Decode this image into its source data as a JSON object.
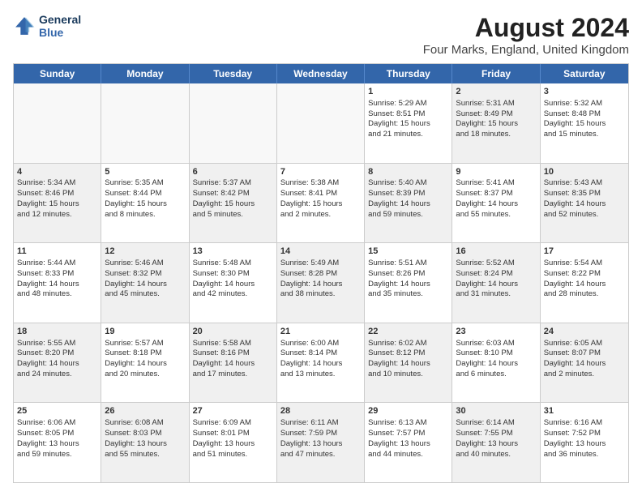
{
  "logo": {
    "line1": "General",
    "line2": "Blue"
  },
  "title": "August 2024",
  "subtitle": "Four Marks, England, United Kingdom",
  "header_days": [
    "Sunday",
    "Monday",
    "Tuesday",
    "Wednesday",
    "Thursday",
    "Friday",
    "Saturday"
  ],
  "rows": [
    [
      {
        "day": "",
        "content": "",
        "empty": true
      },
      {
        "day": "",
        "content": "",
        "empty": true
      },
      {
        "day": "",
        "content": "",
        "empty": true
      },
      {
        "day": "",
        "content": "",
        "empty": true
      },
      {
        "day": "1",
        "content": "Sunrise: 5:29 AM\nSunset: 8:51 PM\nDaylight: 15 hours\nand 21 minutes.",
        "empty": false,
        "shaded": false
      },
      {
        "day": "2",
        "content": "Sunrise: 5:31 AM\nSunset: 8:49 PM\nDaylight: 15 hours\nand 18 minutes.",
        "empty": false,
        "shaded": true
      },
      {
        "day": "3",
        "content": "Sunrise: 5:32 AM\nSunset: 8:48 PM\nDaylight: 15 hours\nand 15 minutes.",
        "empty": false,
        "shaded": false
      }
    ],
    [
      {
        "day": "4",
        "content": "Sunrise: 5:34 AM\nSunset: 8:46 PM\nDaylight: 15 hours\nand 12 minutes.",
        "empty": false,
        "shaded": true
      },
      {
        "day": "5",
        "content": "Sunrise: 5:35 AM\nSunset: 8:44 PM\nDaylight: 15 hours\nand 8 minutes.",
        "empty": false,
        "shaded": false
      },
      {
        "day": "6",
        "content": "Sunrise: 5:37 AM\nSunset: 8:42 PM\nDaylight: 15 hours\nand 5 minutes.",
        "empty": false,
        "shaded": true
      },
      {
        "day": "7",
        "content": "Sunrise: 5:38 AM\nSunset: 8:41 PM\nDaylight: 15 hours\nand 2 minutes.",
        "empty": false,
        "shaded": false
      },
      {
        "day": "8",
        "content": "Sunrise: 5:40 AM\nSunset: 8:39 PM\nDaylight: 14 hours\nand 59 minutes.",
        "empty": false,
        "shaded": true
      },
      {
        "day": "9",
        "content": "Sunrise: 5:41 AM\nSunset: 8:37 PM\nDaylight: 14 hours\nand 55 minutes.",
        "empty": false,
        "shaded": false
      },
      {
        "day": "10",
        "content": "Sunrise: 5:43 AM\nSunset: 8:35 PM\nDaylight: 14 hours\nand 52 minutes.",
        "empty": false,
        "shaded": true
      }
    ],
    [
      {
        "day": "11",
        "content": "Sunrise: 5:44 AM\nSunset: 8:33 PM\nDaylight: 14 hours\nand 48 minutes.",
        "empty": false,
        "shaded": false
      },
      {
        "day": "12",
        "content": "Sunrise: 5:46 AM\nSunset: 8:32 PM\nDaylight: 14 hours\nand 45 minutes.",
        "empty": false,
        "shaded": true
      },
      {
        "day": "13",
        "content": "Sunrise: 5:48 AM\nSunset: 8:30 PM\nDaylight: 14 hours\nand 42 minutes.",
        "empty": false,
        "shaded": false
      },
      {
        "day": "14",
        "content": "Sunrise: 5:49 AM\nSunset: 8:28 PM\nDaylight: 14 hours\nand 38 minutes.",
        "empty": false,
        "shaded": true
      },
      {
        "day": "15",
        "content": "Sunrise: 5:51 AM\nSunset: 8:26 PM\nDaylight: 14 hours\nand 35 minutes.",
        "empty": false,
        "shaded": false
      },
      {
        "day": "16",
        "content": "Sunrise: 5:52 AM\nSunset: 8:24 PM\nDaylight: 14 hours\nand 31 minutes.",
        "empty": false,
        "shaded": true
      },
      {
        "day": "17",
        "content": "Sunrise: 5:54 AM\nSunset: 8:22 PM\nDaylight: 14 hours\nand 28 minutes.",
        "empty": false,
        "shaded": false
      }
    ],
    [
      {
        "day": "18",
        "content": "Sunrise: 5:55 AM\nSunset: 8:20 PM\nDaylight: 14 hours\nand 24 minutes.",
        "empty": false,
        "shaded": true
      },
      {
        "day": "19",
        "content": "Sunrise: 5:57 AM\nSunset: 8:18 PM\nDaylight: 14 hours\nand 20 minutes.",
        "empty": false,
        "shaded": false
      },
      {
        "day": "20",
        "content": "Sunrise: 5:58 AM\nSunset: 8:16 PM\nDaylight: 14 hours\nand 17 minutes.",
        "empty": false,
        "shaded": true
      },
      {
        "day": "21",
        "content": "Sunrise: 6:00 AM\nSunset: 8:14 PM\nDaylight: 14 hours\nand 13 minutes.",
        "empty": false,
        "shaded": false
      },
      {
        "day": "22",
        "content": "Sunrise: 6:02 AM\nSunset: 8:12 PM\nDaylight: 14 hours\nand 10 minutes.",
        "empty": false,
        "shaded": true
      },
      {
        "day": "23",
        "content": "Sunrise: 6:03 AM\nSunset: 8:10 PM\nDaylight: 14 hours\nand 6 minutes.",
        "empty": false,
        "shaded": false
      },
      {
        "day": "24",
        "content": "Sunrise: 6:05 AM\nSunset: 8:07 PM\nDaylight: 14 hours\nand 2 minutes.",
        "empty": false,
        "shaded": true
      }
    ],
    [
      {
        "day": "25",
        "content": "Sunrise: 6:06 AM\nSunset: 8:05 PM\nDaylight: 13 hours\nand 59 minutes.",
        "empty": false,
        "shaded": false
      },
      {
        "day": "26",
        "content": "Sunrise: 6:08 AM\nSunset: 8:03 PM\nDaylight: 13 hours\nand 55 minutes.",
        "empty": false,
        "shaded": true
      },
      {
        "day": "27",
        "content": "Sunrise: 6:09 AM\nSunset: 8:01 PM\nDaylight: 13 hours\nand 51 minutes.",
        "empty": false,
        "shaded": false
      },
      {
        "day": "28",
        "content": "Sunrise: 6:11 AM\nSunset: 7:59 PM\nDaylight: 13 hours\nand 47 minutes.",
        "empty": false,
        "shaded": true
      },
      {
        "day": "29",
        "content": "Sunrise: 6:13 AM\nSunset: 7:57 PM\nDaylight: 13 hours\nand 44 minutes.",
        "empty": false,
        "shaded": false
      },
      {
        "day": "30",
        "content": "Sunrise: 6:14 AM\nSunset: 7:55 PM\nDaylight: 13 hours\nand 40 minutes.",
        "empty": false,
        "shaded": true
      },
      {
        "day": "31",
        "content": "Sunrise: 6:16 AM\nSunset: 7:52 PM\nDaylight: 13 hours\nand 36 minutes.",
        "empty": false,
        "shaded": false
      }
    ]
  ]
}
